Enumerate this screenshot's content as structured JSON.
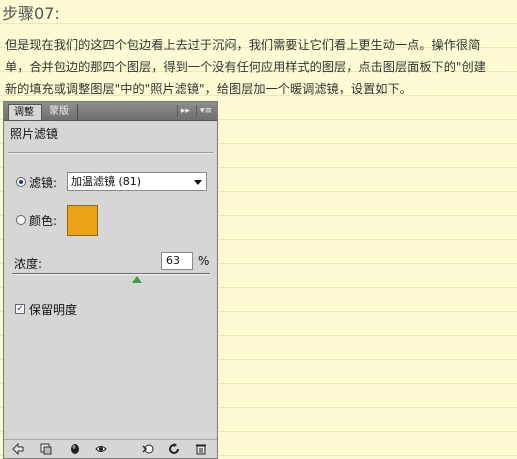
{
  "step": {
    "title": "步骤07:"
  },
  "article": {
    "lines": [
      "但是现在我们的这四个包边看上去过于沉闷，我们需要让它们看上更生动一点。操作很简",
      "单，合并包边的那四个图层，得到一个没有任何应用样式的图层，点击图层面板下的\"创建",
      "新的填充或调整图层\"中的\"照片滤镜\"，给图层加一个暖调滤镜，设置如下。"
    ]
  },
  "panel": {
    "tabs": [
      {
        "label": "调整",
        "active": true
      },
      {
        "label": "蒙版",
        "active": false
      }
    ],
    "tab_buttons": [
      "▸▸",
      "▾≡"
    ],
    "heading": "照片滤镜",
    "filter": {
      "label": "滤镜:",
      "selected": true,
      "value": "加温滤镜 (81)"
    },
    "color": {
      "label": "颜色:",
      "selected": false,
      "swatch": "#eba318"
    },
    "density": {
      "label": "浓度:",
      "value": "63",
      "unit": "%",
      "level_percent": 63
    },
    "preserve_luminosity": {
      "label": "保留明度",
      "checked": true,
      "mark": "✓"
    },
    "bottom_icons": [
      "back-arrow-icon",
      "clip-layers-icon",
      "visibility-mask-icon",
      "eye-icon",
      "view-previous-icon",
      "reset-icon",
      "trash-icon"
    ]
  }
}
